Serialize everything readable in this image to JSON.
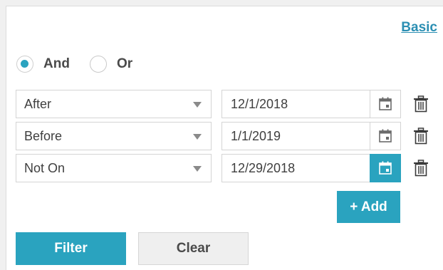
{
  "colors": {
    "accent": "#2aa3bf",
    "link": "#2b8fb3"
  },
  "basic_link": "Basic",
  "logic": {
    "options": [
      {
        "label": "And",
        "checked": true
      },
      {
        "label": "Or",
        "checked": false
      }
    ]
  },
  "conditions": [
    {
      "operator": "After",
      "date": "12/1/2018",
      "calendar_icon": "calendar-icon",
      "calendar_active": false
    },
    {
      "operator": "Before",
      "date": "1/1/2019",
      "calendar_icon": "calendar-icon",
      "calendar_active": false
    },
    {
      "operator": "Not On",
      "date": "12/29/2018",
      "calendar_icon": "calendar-icon",
      "calendar_active": true
    }
  ],
  "add_label": "+ Add",
  "filter_label": "Filter",
  "clear_label": "Clear"
}
